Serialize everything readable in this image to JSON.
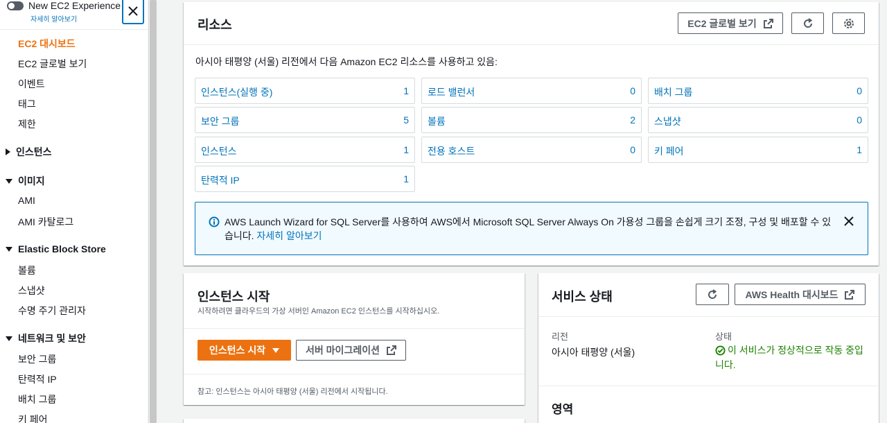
{
  "sidebar": {
    "toggle_label": "New EC2 Experience",
    "toggle_link": "자세히 알아보기",
    "items": [
      {
        "label": "EC2 대시보드"
      },
      {
        "label": "EC2 글로벌 보기"
      },
      {
        "label": "이벤트"
      },
      {
        "label": "태그"
      },
      {
        "label": "제한"
      }
    ],
    "sections": [
      {
        "label": "인스턴스",
        "expanded": false
      },
      {
        "label": "이미지",
        "expanded": true,
        "items": [
          "AMI",
          "AMI 카탈로그"
        ]
      },
      {
        "label": "Elastic Block Store",
        "expanded": true,
        "items": [
          "볼륨",
          "스냅샷",
          "수명 주기 관리자"
        ]
      },
      {
        "label": "네트워크 및 보안",
        "expanded": true,
        "items": [
          "보안 그룹",
          "탄력적 IP",
          "배치 그룹",
          "키 페어"
        ]
      }
    ]
  },
  "resources": {
    "title": "리소스",
    "global_view_button": "EC2 글로벌 보기",
    "intro": "아시아 태평양 (서울) 리전에서 다음 Amazon EC2 리소스를 사용하고 있음:",
    "items": [
      {
        "label": "인스턴스(실행 중)",
        "count": "1"
      },
      {
        "label": "로드 밸런서",
        "count": "0"
      },
      {
        "label": "배치 그룹",
        "count": "0"
      },
      {
        "label": "보안 그룹",
        "count": "5"
      },
      {
        "label": "볼륨",
        "count": "2"
      },
      {
        "label": "스냅샷",
        "count": "0"
      },
      {
        "label": "인스턴스",
        "count": "1"
      },
      {
        "label": "전용 호스트",
        "count": "0"
      },
      {
        "label": "키 페어",
        "count": "1"
      },
      {
        "label": "탄력적 IP",
        "count": "1"
      }
    ],
    "info_text": "AWS Launch Wizard for SQL Server를 사용하여 AWS에서 Microsoft SQL Server Always On 가용성 그룹을 손쉽게 크기 조정, 구성 및 배포할 수 있습니다.",
    "info_link": "자세히 알아보기"
  },
  "launch": {
    "title": "인스턴스 시작",
    "subtitle": "시작하려면 클라우드의 가상 서버인 Amazon EC2 인스턴스를 시작하십시오.",
    "launch_button": "인스턴스 시작",
    "migrate_button": "서버 마이그레이션",
    "note": "참고: 인스턴스는 아시아 태평양 (서울) 리전에서 시작됩니다."
  },
  "health": {
    "title": "서비스 상태",
    "aws_health_button": "AWS Health 대시보드",
    "region_key": "리전",
    "region_value": "아시아 태평양 (서울)",
    "status_key": "상태",
    "status_value": "이 서비스가 정상적으로 작동 중입니다.",
    "zones_title": "영역"
  },
  "colors": {
    "accent": "#ec7211",
    "link": "#0073bb",
    "success": "#1d8102"
  }
}
